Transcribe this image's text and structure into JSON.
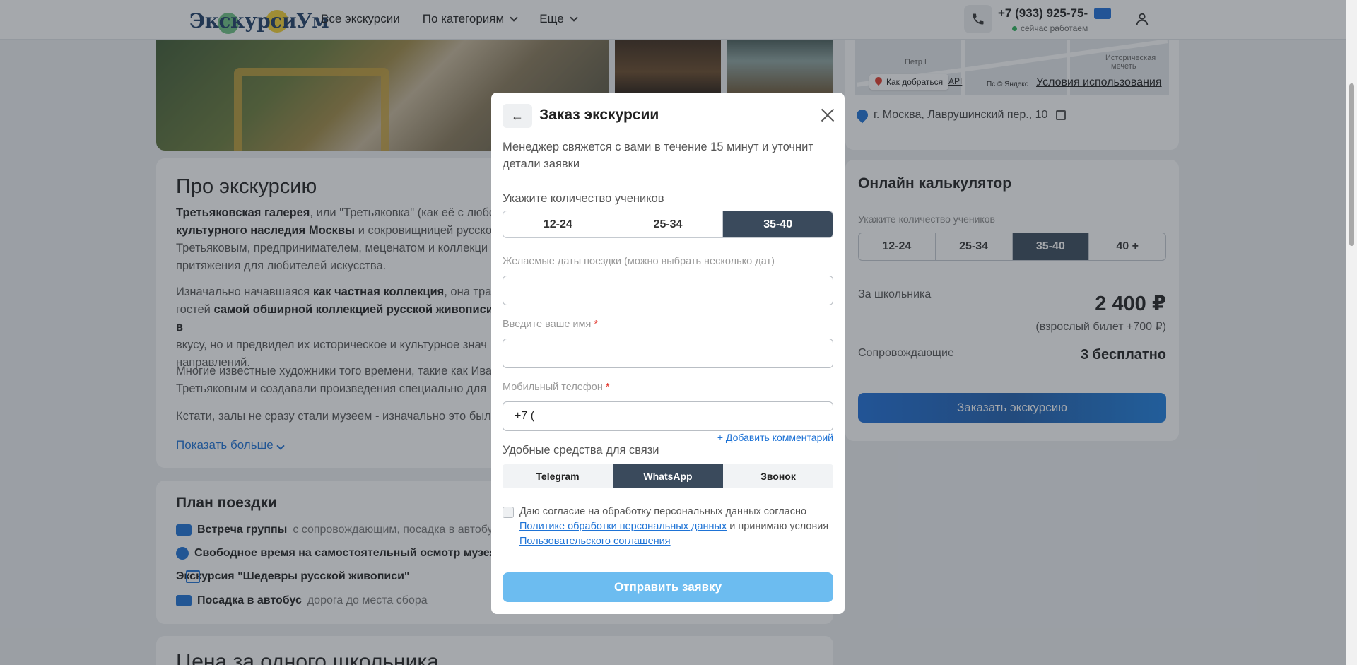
{
  "header": {
    "logo_text": "ЭкскурсиУм",
    "nav": [
      "Все экскурсии",
      "По категориям",
      "Еще"
    ],
    "phone": "+7 (933) 925-75-",
    "status": "сейчас работаем"
  },
  "about": {
    "title": "Про экскурсию",
    "p1_b1": "Третьяковская галерея",
    "p1_t1": ", или \"Третьяковка\" (как её с любо",
    "p1_b2": "культурного наследия Москвы",
    "p1_t2": " и сокровищницей русской",
    "p1_t3": "Третьяковым, предпринимателем, меценатом и коллекци",
    "p1_t4": "притяжения для любителей искусства.",
    "p2_t1": "Изначально начавшаяся ",
    "p2_b1": "как частная коллекция",
    "p2_t2": ", она тран",
    "p2_t3": "гостей ",
    "p2_b2": "самой обширной коллекцией русской живописи в",
    "p2_t4": "вкусу, но и предвидел их историческое и культурное знач",
    "p2_t5": "направлений.",
    "p3_t1": "Многие известные художники того времени, такие как Ива",
    "p3_t2": "Третьяковым и создавали произведения специально для",
    "p4_t1": "Кстати, залы не сразу стали музеем - изначально это был",
    "show_more": "Показать больше"
  },
  "plan": {
    "title": "План поездки",
    "items": [
      {
        "bold": "Встреча группы",
        "text": "с сопровождающим, посадка в автобус"
      },
      {
        "bold": "Свободное время на самостоятельный осмотр музея",
        "text": ""
      },
      {
        "bold": "Экскурсия \"Шедевры русской живописи\"",
        "text": ""
      },
      {
        "bold": "Посадка в автобус",
        "text": "дорога до места сбора"
      }
    ]
  },
  "price_title": "Цена за одного школьника",
  "map": {
    "how_to_get": "Как добраться",
    "api": "API",
    "yandex": "Пс © Яндекс",
    "terms": "Условия использования",
    "label_petr": "Петр I",
    "label_hist": "Историческая",
    "label_hist2": "мечеть",
    "address": "г. Москва, Лаврушинский пер., 10"
  },
  "calc": {
    "title": "Онлайн калькулятор",
    "hint": "Укажите количество учеников",
    "options": [
      "12-24",
      "25-34",
      "35-40",
      "40 +"
    ],
    "active_index": 2,
    "per_student_label": "За школьника",
    "per_student_value": "2 400 ₽",
    "adult_note": "(взрослый билет +700 ₽)",
    "companions_label": "Сопровождающие",
    "companions_value": "3 бесплатно",
    "order_button": "Заказать экскурсию"
  },
  "modal": {
    "title": "Заказ экскурсии",
    "back": "←",
    "description": "Менеджер свяжется с вами в течение 15 минут и уточнит детали заявки",
    "students_label": "Укажите количество учеников",
    "students_options": [
      "12-24",
      "25-34",
      "35-40"
    ],
    "students_active": 2,
    "dates_label": "Желаемые даты поездки (можно выбрать несколько дат)",
    "dates_value": "",
    "name_label": "Введите ваше имя",
    "name_value": "",
    "phone_label": "Мобильный телефон",
    "phone_value": "+7 (",
    "required_mark": "*",
    "add_comment": "+ Добавить комментарий",
    "contact_label": "Удобные средства для связи",
    "contact_options": [
      "Telegram",
      "WhatsApp",
      "Звонок"
    ],
    "contact_active": 1,
    "consent_t1": "Даю согласие на обработку персональных данных согласно",
    "consent_link1": "Политике обработки персональных данных",
    "consent_t2": " и принимаю условия",
    "consent_link2": "Пользовательского соглашения",
    "submit": "Отправить заявку"
  }
}
